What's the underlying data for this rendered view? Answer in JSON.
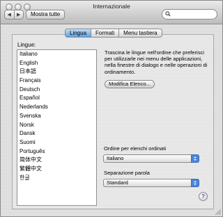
{
  "window": {
    "title": "Internazionale"
  },
  "toolbar": {
    "back_label": "◀",
    "forward_label": "▶",
    "show_all_label": "Mostra tutte",
    "search_value": ""
  },
  "tabs": [
    {
      "label": "Lingua",
      "active": true
    },
    {
      "label": "Formati",
      "active": false
    },
    {
      "label": "Menu tastiera",
      "active": false
    }
  ],
  "languages": {
    "label": "Lingue:",
    "items": [
      "Italiano",
      "English",
      "日本語",
      "Français",
      "Deutsch",
      "Español",
      "Nederlands",
      "Svenska",
      "Norsk",
      "Dansk",
      "Suomi",
      "Português",
      "简体中文",
      "繁體中文",
      "한글"
    ]
  },
  "instructions": "Trascina le lingue nell'ordine che preferisci per utilizzarle nei menu delle applicazioni, nella finestre di dialogo e nelle operazioni di ordinamento.",
  "edit_list_label": "Modifica Elenco...",
  "sort_order": {
    "label": "Ordine per elenchi ordinati",
    "value": "Italiano"
  },
  "word_break": {
    "label": "Separazione parola",
    "value": "Standard"
  },
  "help_label": "?"
}
